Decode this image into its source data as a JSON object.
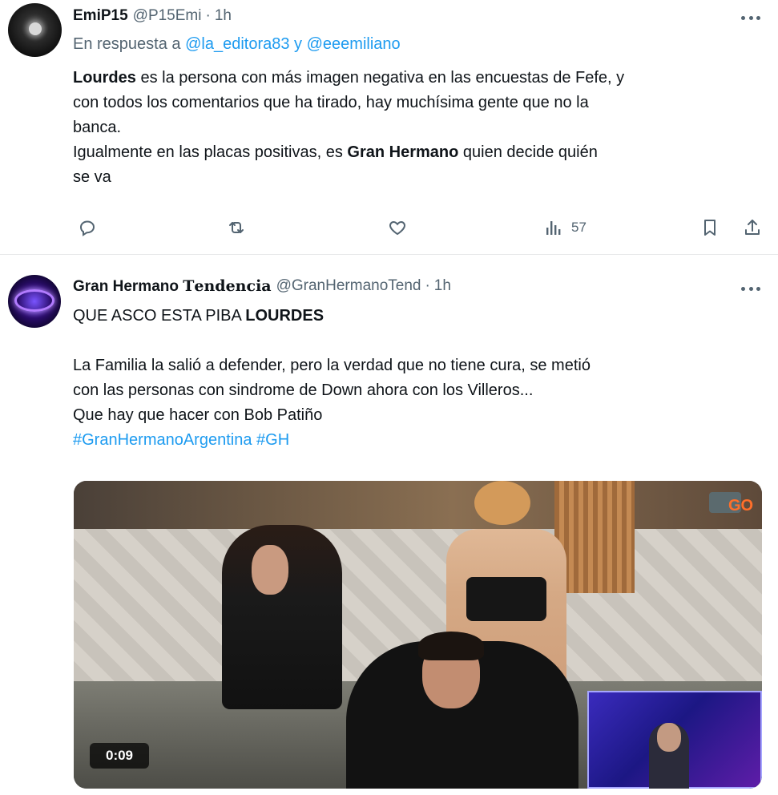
{
  "tweets": [
    {
      "name": "EmiP15",
      "handle": "@P15Emi",
      "separator": "·",
      "time": "1h",
      "reply_prefix": "En respuesta a ",
      "reply_user1": "@la_editora83",
      "reply_and": " y ",
      "reply_user2": "@eeemiliano",
      "text": {
        "l1_bold": "Lourdes",
        "l1_rest": " es la persona con más imagen negativa en las encuestas de Fefe, y",
        "l2": "con todos los comentarios que ha tirado, hay muchísima gente que no la",
        "l3": "banca.",
        "l4_pre": "Igualmente en las placas positivas, es ",
        "l4_bold": "Gran Hermano",
        "l4_post": " quien decide quién",
        "l5": "se va"
      },
      "actions": {
        "reply_icon": "reply-icon",
        "retweet_icon": "retweet-icon",
        "like_icon": "heart-icon",
        "views_icon": "views-icon",
        "views_count": "57",
        "bookmark_icon": "bookmark-icon",
        "share_icon": "share-icon"
      }
    },
    {
      "name_part1": "Gran Hermano ",
      "name_part2": "𝐓𝐞𝐧𝐝𝐞𝐧𝐜𝐢𝐚",
      "handle": "@GranHermanoTend",
      "separator": "·",
      "time": "1h",
      "text": {
        "l1_pre": "QUE ASCO ESTA PIBA ",
        "l1_bold": "LOURDES",
        "l2": "La Familia la salió a defender, pero la verdad que no tiene cura, se metió",
        "l3": "con las personas con sindrome de Down ahora con los Villeros...",
        "l4": "Que hay que hacer con Bob Patiño",
        "hashtag1": "#GranHermanoArgentina",
        "hashtag2": "#GH"
      },
      "video": {
        "duration": "0:09",
        "channel_bug_text": "GO"
      }
    }
  ],
  "colors": {
    "text": "#0f1419",
    "muted": "#536471",
    "link": "#1d9bf0",
    "divider": "#e7e9ea"
  }
}
